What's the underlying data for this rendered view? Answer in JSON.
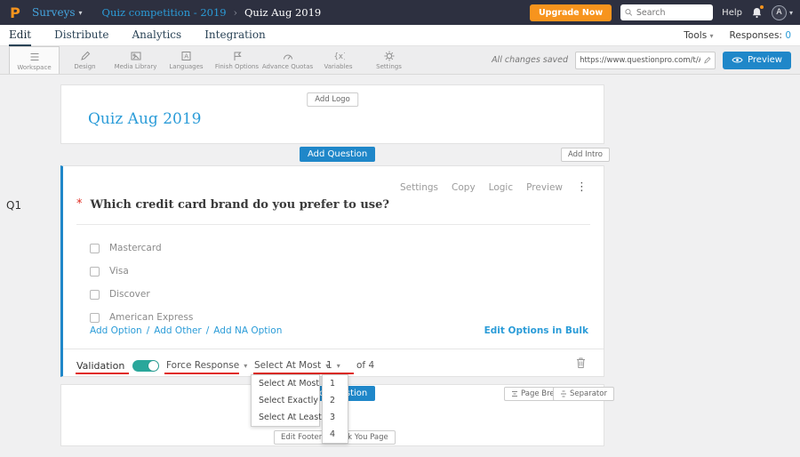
{
  "icons": {
    "caret": "▾",
    "chevron": "›",
    "ellipsis": "⋮"
  },
  "topbar": {
    "logo": "P",
    "surveys_label": "Surveys",
    "breadcrumb_parent": "Quiz competition - 2019",
    "breadcrumb_current": "Quiz Aug 2019",
    "upgrade_label": "Upgrade Now",
    "search_placeholder": "Search",
    "help_label": "Help",
    "avatar_letter": "A"
  },
  "nav": {
    "tabs": [
      {
        "label": "Edit"
      },
      {
        "label": "Distribute"
      },
      {
        "label": "Analytics"
      },
      {
        "label": "Integration"
      }
    ],
    "tools_label": "Tools",
    "responses_label": "Responses:",
    "responses_count": "0"
  },
  "toolbar": {
    "items": [
      {
        "label": "Workspace"
      },
      {
        "label": "Design"
      },
      {
        "label": "Media Library"
      },
      {
        "label": "Languages"
      },
      {
        "label": "Finish Options"
      },
      {
        "label": "Advance Quotas"
      },
      {
        "label": "Variables"
      },
      {
        "label": "Settings"
      }
    ],
    "saved_status": "All changes saved",
    "url_value": "https://www.questionpro.com/t/APNrFZ",
    "preview_label": "Preview"
  },
  "survey": {
    "add_logo_label": "Add Logo",
    "title": "Quiz Aug 2019",
    "add_question_label": "Add Question",
    "add_intro_label": "Add Intro"
  },
  "question": {
    "id_label": "Q1",
    "actions": [
      "Settings",
      "Copy",
      "Logic",
      "Preview"
    ],
    "required_marker": "*",
    "text": "Which credit card brand do you prefer to use?",
    "options": [
      "Mastercard",
      "Visa",
      "Discover",
      "American Express"
    ],
    "add_option_label": "Add Option",
    "add_other_label": "Add Other",
    "add_na_label": "Add NA Option",
    "link_separator": "/",
    "edit_bulk_label": "Edit Options in Bulk",
    "validation_label": "Validation",
    "force_response_label": "Force Response",
    "select_mode_value": "Select At Most",
    "count_value": "1",
    "of_label": "of 4"
  },
  "dropdown": {
    "mode_options": [
      "Select At Most",
      "Select Exactly",
      "Select At Least"
    ],
    "count_options": [
      "1",
      "2",
      "3",
      "4"
    ]
  },
  "footer": {
    "add_question_label": "Add Question",
    "page_break_label": "Page Break",
    "separator_label": "Separator",
    "edit_footer_label": "Edit Footer",
    "thank_you_label": "Thank You Page"
  }
}
